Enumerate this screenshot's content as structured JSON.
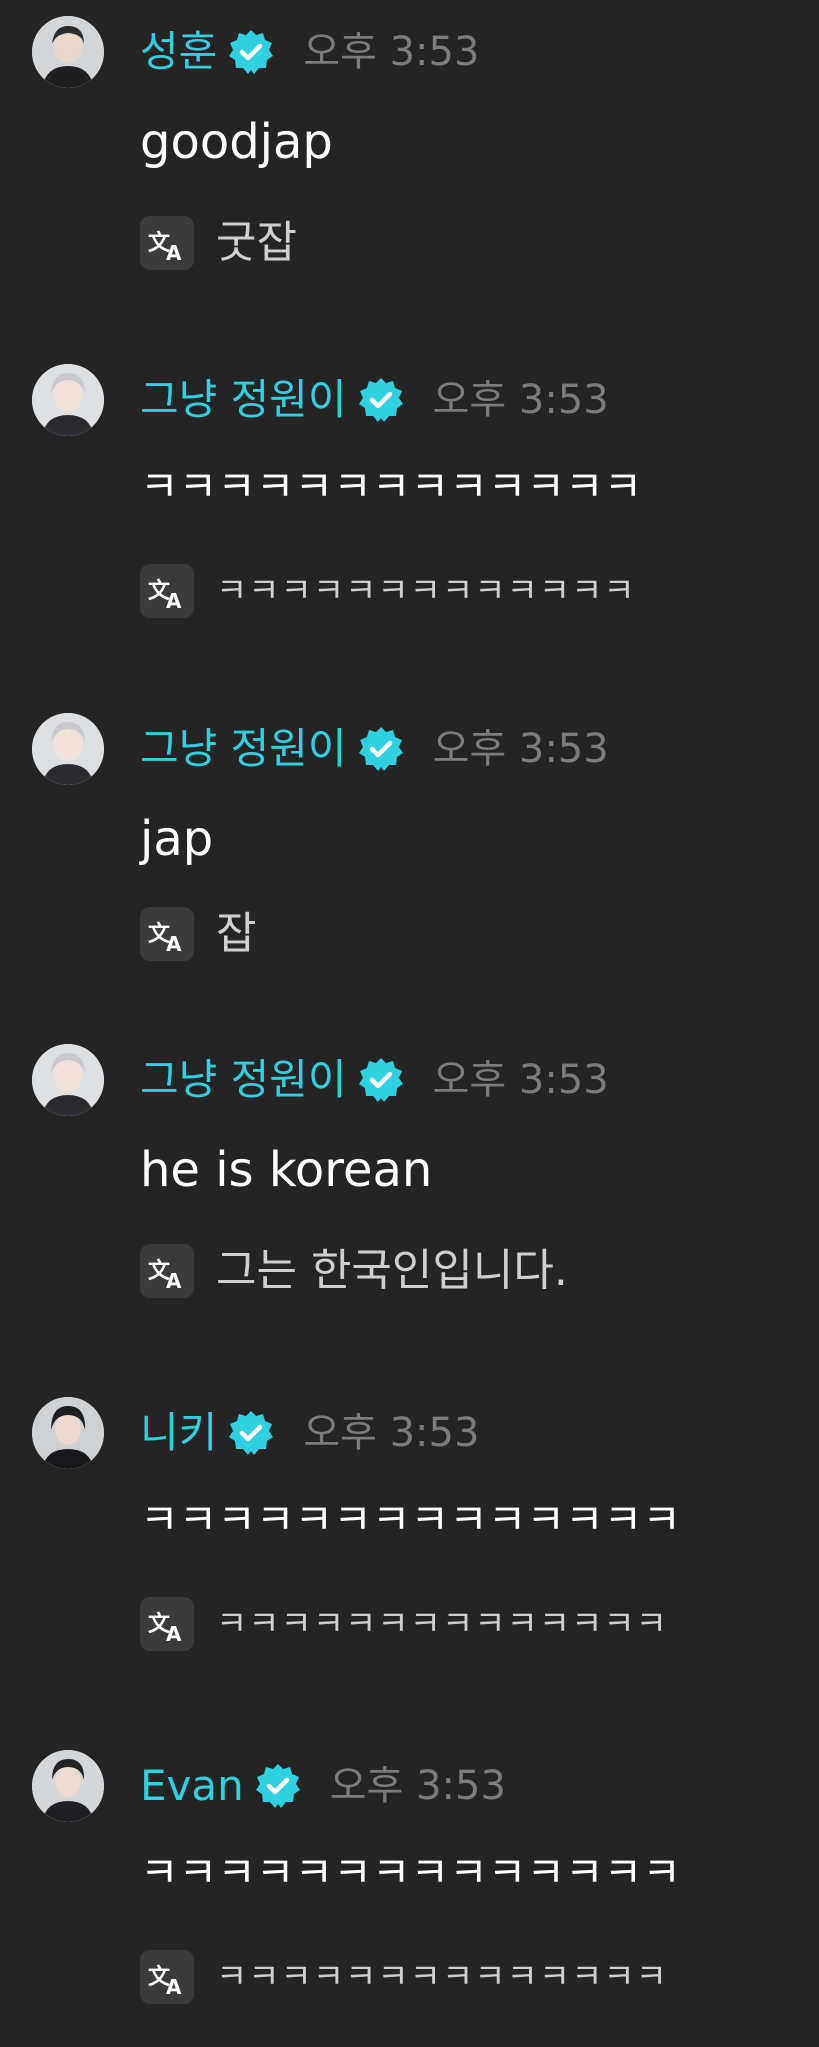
{
  "messages": [
    {
      "username": "성훈",
      "time": "오후 3:53",
      "text": "goodjap",
      "translation": "굿잡",
      "avatar_color": "#cfd3d6"
    },
    {
      "username": "그냥 정원이",
      "time": "오후 3:53",
      "text": "ㅋㅋㅋㅋㅋㅋㅋㅋㅋㅋㅋㅋㅋ",
      "translation": "ㅋㅋㅋㅋㅋㅋㅋㅋㅋㅋㅋㅋㅋ",
      "avatar_color": "#d9dde0"
    },
    {
      "username": "그냥 정원이",
      "time": "오후 3:53",
      "text": "jap",
      "translation": "잡",
      "avatar_color": "#d9dde0"
    },
    {
      "username": "그냥 정원이",
      "time": "오후 3:53",
      "text": "he is korean",
      "translation": "그는 한국인입니다.",
      "avatar_color": "#d9dde0"
    },
    {
      "username": "니키",
      "time": "오후 3:53",
      "text": "ㅋㅋㅋㅋㅋㅋㅋㅋㅋㅋㅋㅋㅋㅋ",
      "translation": "ㅋㅋㅋㅋㅋㅋㅋㅋㅋㅋㅋㅋㅋㅋ",
      "avatar_color": "#cdd0d3"
    },
    {
      "username": "Evan",
      "time": "오후 3:53",
      "text": "ㅋㅋㅋㅋㅋㅋㅋㅋㅋㅋㅋㅋㅋㅋ",
      "translation": "ㅋㅋㅋㅋㅋㅋㅋㅋㅋㅋㅋㅋㅋㅋ",
      "avatar_color": "#d3d6d8"
    }
  ],
  "colors": {
    "background": "#242424",
    "username": "#2fd0e0",
    "verified_badge": "#2fd0e0",
    "timestamp": "#7c7c7c",
    "message_text": "#ffffff",
    "translation_text": "#cfcfcf",
    "translate_icon_bg": "#3b3b3b"
  },
  "icons": {
    "verified": "verified-badge-icon",
    "translate": "translate-icon"
  }
}
